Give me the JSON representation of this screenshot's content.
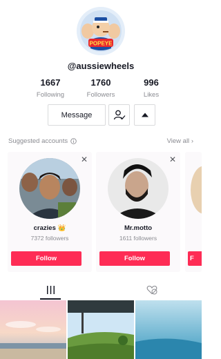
{
  "profile": {
    "avatar_text": "POPEYE",
    "username": "@aussiewheels",
    "stats": [
      {
        "value": "1667",
        "label": "Following"
      },
      {
        "value": "1760",
        "label": "Followers"
      },
      {
        "value": "996",
        "label": "Likes"
      }
    ],
    "message_label": "Message"
  },
  "suggested": {
    "title": "Suggested accounts",
    "view_all": "View all",
    "accounts": [
      {
        "name": "crazies 👑",
        "followers": "7372 followers",
        "follow_label": "Follow"
      },
      {
        "name": "Mr.motto",
        "followers": "1611 followers",
        "follow_label": "Follow"
      },
      {
        "name": "",
        "followers": "",
        "follow_label": "F"
      }
    ]
  },
  "tabs": {
    "videos_icon": "grid-lines-icon",
    "liked_icon": "heart-eye-slash-icon"
  },
  "colors": {
    "accent": "#fe2c55",
    "text": "#161823",
    "muted": "#8a8b91"
  }
}
